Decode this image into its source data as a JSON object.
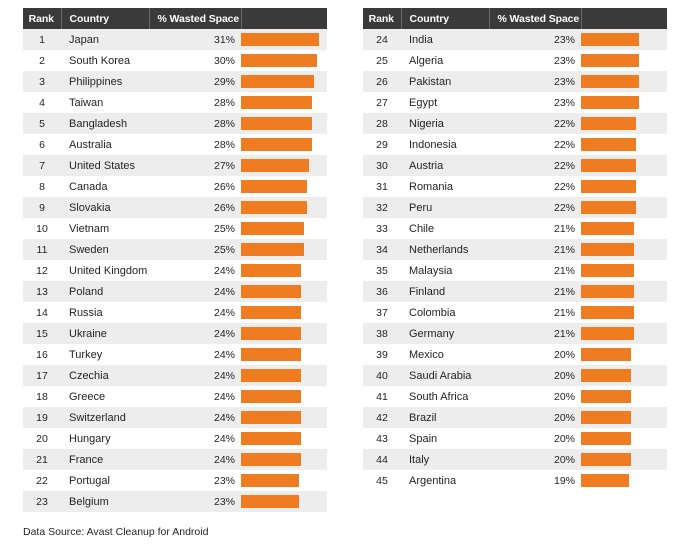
{
  "columns": {
    "rank": "Rank",
    "country": "Country",
    "pct": "% Wasted Space",
    "bar": ""
  },
  "footnote": "Data Source: Avast Cleanup for Android",
  "colors": {
    "bar": "#f07c22",
    "header_bg": "#3a3a3a",
    "row_alt": "#ededed",
    "row_base": "#ffffff",
    "text": "#231f20"
  },
  "chart_data": {
    "type": "bar",
    "title": "",
    "xlabel": "% Wasted Space",
    "ylabel": "Country",
    "orientation": "horizontal",
    "value_unit": "%",
    "xlim": [
      0,
      31
    ],
    "grid": false,
    "legend": null,
    "source": "Data Source: Avast Cleanup for Android",
    "categories": [
      "Japan",
      "South Korea",
      "Philippines",
      "Taiwan",
      "Bangladesh",
      "Australia",
      "United States",
      "Canada",
      "Slovakia",
      "Vietnam",
      "Sweden",
      "United Kingdom",
      "Poland",
      "Russia",
      "Ukraine",
      "Turkey",
      "Czechia",
      "Greece",
      "Switzerland",
      "Hungary",
      "France",
      "Portugal",
      "Belgium",
      "India",
      "Algeria",
      "Pakistan",
      "Egypt",
      "Nigeria",
      "Indonesia",
      "Austria",
      "Romania",
      "Peru",
      "Chile",
      "Netherlands",
      "Malaysia",
      "Finland",
      "Colombia",
      "Germany",
      "Mexico",
      "Saudi Arabia",
      "South Africa",
      "Brazil",
      "Spain",
      "Italy",
      "Argentina"
    ],
    "values": [
      31,
      30,
      29,
      28,
      28,
      28,
      27,
      26,
      26,
      25,
      25,
      24,
      24,
      24,
      24,
      24,
      24,
      24,
      24,
      24,
      24,
      23,
      23,
      23,
      23,
      23,
      23,
      22,
      22,
      22,
      22,
      22,
      21,
      21,
      21,
      21,
      21,
      21,
      20,
      20,
      20,
      20,
      20,
      20,
      19
    ]
  },
  "tables": [
    {
      "id": "left",
      "rows": [
        {
          "rank": "1",
          "country": "Japan",
          "pct": "31%",
          "value": 31
        },
        {
          "rank": "2",
          "country": "South Korea",
          "pct": "30%",
          "value": 30
        },
        {
          "rank": "3",
          "country": "Philippines",
          "pct": "29%",
          "value": 29
        },
        {
          "rank": "4",
          "country": "Taiwan",
          "pct": "28%",
          "value": 28
        },
        {
          "rank": "5",
          "country": "Bangladesh",
          "pct": "28%",
          "value": 28
        },
        {
          "rank": "6",
          "country": "Australia",
          "pct": "28%",
          "value": 28
        },
        {
          "rank": "7",
          "country": "United States",
          "pct": "27%",
          "value": 27
        },
        {
          "rank": "8",
          "country": "Canada",
          "pct": "26%",
          "value": 26
        },
        {
          "rank": "9",
          "country": "Slovakia",
          "pct": "26%",
          "value": 26
        },
        {
          "rank": "10",
          "country": "Vietnam",
          "pct": "25%",
          "value": 25
        },
        {
          "rank": "11",
          "country": "Sweden",
          "pct": "25%",
          "value": 25
        },
        {
          "rank": "12",
          "country": "United Kingdom",
          "pct": "24%",
          "value": 24
        },
        {
          "rank": "13",
          "country": "Poland",
          "pct": "24%",
          "value": 24
        },
        {
          "rank": "14",
          "country": "Russia",
          "pct": "24%",
          "value": 24
        },
        {
          "rank": "15",
          "country": "Ukraine",
          "pct": "24%",
          "value": 24
        },
        {
          "rank": "16",
          "country": "Turkey",
          "pct": "24%",
          "value": 24
        },
        {
          "rank": "17",
          "country": "Czechia",
          "pct": "24%",
          "value": 24
        },
        {
          "rank": "18",
          "country": "Greece",
          "pct": "24%",
          "value": 24
        },
        {
          "rank": "19",
          "country": "Switzerland",
          "pct": "24%",
          "value": 24
        },
        {
          "rank": "20",
          "country": "Hungary",
          "pct": "24%",
          "value": 24
        },
        {
          "rank": "21",
          "country": "France",
          "pct": "24%",
          "value": 24
        },
        {
          "rank": "22",
          "country": "Portugal",
          "pct": "23%",
          "value": 23
        },
        {
          "rank": "23",
          "country": "Belgium",
          "pct": "23%",
          "value": 23
        }
      ]
    },
    {
      "id": "right",
      "rows": [
        {
          "rank": "24",
          "country": "India",
          "pct": "23%",
          "value": 23
        },
        {
          "rank": "25",
          "country": "Algeria",
          "pct": "23%",
          "value": 23
        },
        {
          "rank": "26",
          "country": "Pakistan",
          "pct": "23%",
          "value": 23
        },
        {
          "rank": "27",
          "country": "Egypt",
          "pct": "23%",
          "value": 23
        },
        {
          "rank": "28",
          "country": "Nigeria",
          "pct": "22%",
          "value": 22
        },
        {
          "rank": "29",
          "country": "Indonesia",
          "pct": "22%",
          "value": 22
        },
        {
          "rank": "30",
          "country": "Austria",
          "pct": "22%",
          "value": 22
        },
        {
          "rank": "31",
          "country": "Romania",
          "pct": "22%",
          "value": 22
        },
        {
          "rank": "32",
          "country": "Peru",
          "pct": "22%",
          "value": 22
        },
        {
          "rank": "33",
          "country": "Chile",
          "pct": "21%",
          "value": 21
        },
        {
          "rank": "34",
          "country": "Netherlands",
          "pct": "21%",
          "value": 21
        },
        {
          "rank": "35",
          "country": "Malaysia",
          "pct": "21%",
          "value": 21
        },
        {
          "rank": "36",
          "country": "Finland",
          "pct": "21%",
          "value": 21
        },
        {
          "rank": "37",
          "country": "Colombia",
          "pct": "21%",
          "value": 21
        },
        {
          "rank": "38",
          "country": "Germany",
          "pct": "21%",
          "value": 21
        },
        {
          "rank": "39",
          "country": "Mexico",
          "pct": "20%",
          "value": 20
        },
        {
          "rank": "40",
          "country": "Saudi Arabia",
          "pct": "20%",
          "value": 20
        },
        {
          "rank": "41",
          "country": "South Africa",
          "pct": "20%",
          "value": 20
        },
        {
          "rank": "42",
          "country": "Brazil",
          "pct": "20%",
          "value": 20
        },
        {
          "rank": "43",
          "country": "Spain",
          "pct": "20%",
          "value": 20
        },
        {
          "rank": "44",
          "country": "Italy",
          "pct": "20%",
          "value": 20
        },
        {
          "rank": "45",
          "country": "Argentina",
          "pct": "19%",
          "value": 19
        }
      ]
    }
  ]
}
